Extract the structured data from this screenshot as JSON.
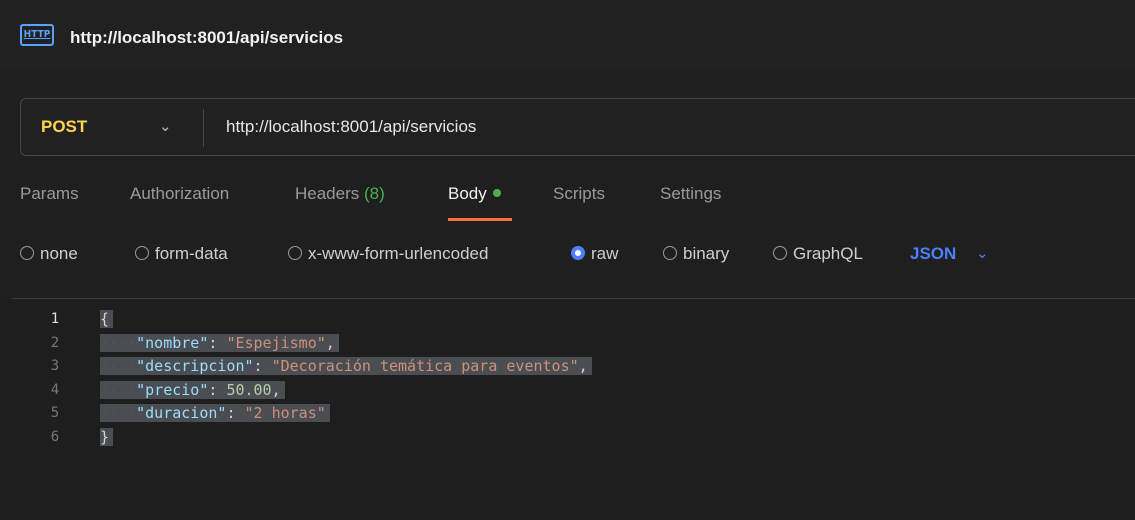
{
  "window": {
    "title": "http://localhost:8001/api/servicios",
    "icon": "http-icon"
  },
  "request": {
    "method": "POST",
    "url": "http://localhost:8001/api/servicios"
  },
  "tabs": [
    {
      "label": "Params"
    },
    {
      "label": "Authorization"
    },
    {
      "label": "Headers",
      "count": "(8)"
    },
    {
      "label": "Body",
      "active": true
    },
    {
      "label": "Scripts"
    },
    {
      "label": "Settings"
    }
  ],
  "body_types": [
    {
      "label": "none",
      "selected": false
    },
    {
      "label": "form-data",
      "selected": false
    },
    {
      "label": "x-www-form-urlencoded",
      "selected": false
    },
    {
      "label": "raw",
      "selected": true
    },
    {
      "label": "binary",
      "selected": false
    },
    {
      "label": "GraphQL",
      "selected": false
    }
  ],
  "body_language": "JSON",
  "editor": {
    "line_numbers": [
      "1",
      "2",
      "3",
      "4",
      "5",
      "6"
    ],
    "lines": [
      {
        "brace": "{"
      },
      {
        "key": "\"nombre\"",
        "value": "\"Espejismo\"",
        "trail": ","
      },
      {
        "key": "\"descripcion\"",
        "value": "\"Decoración temática para eventos\"",
        "trail": ","
      },
      {
        "key": "\"precio\"",
        "value": "50.00",
        "trail": ","
      },
      {
        "key": "\"duracion\"",
        "value": "\"2 horas\"",
        "trail": ""
      },
      {
        "brace": "}"
      }
    ]
  },
  "colors": {
    "method": "#ffd54f",
    "accent": "#ff6c37",
    "selected_radio": "#4d7fff",
    "json_key": "#9cdcfe",
    "json_string": "#ce9178",
    "json_number": "#b5cea8"
  }
}
